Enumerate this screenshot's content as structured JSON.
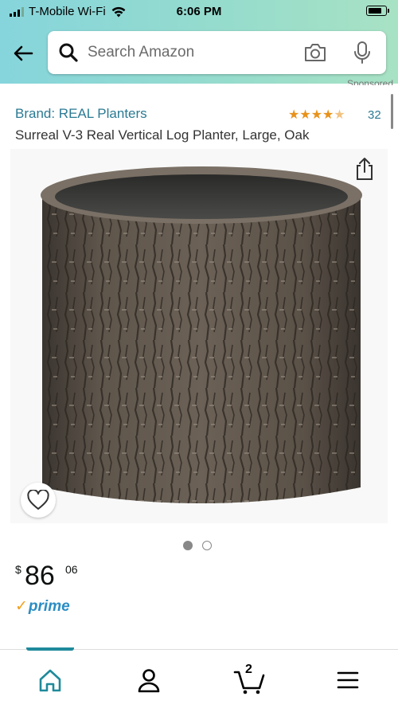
{
  "status_bar": {
    "carrier": "T-Mobile Wi-Fi",
    "time": "6:06 PM",
    "battery_level": 0.8
  },
  "search": {
    "placeholder": "Search Amazon",
    "icons": [
      "back-arrow-icon",
      "search-icon",
      "camera-icon",
      "microphone-icon"
    ]
  },
  "sponsored_label": "Sponsored",
  "product": {
    "brand": "Brand: REAL Planters",
    "rating": 4.5,
    "rating_count": "32",
    "title": "Surreal V-3 Real Vertical Log Planter, Large, Oak",
    "image_count": 2,
    "active_image": 1,
    "price": {
      "currency": "$",
      "whole": "86",
      "fraction": "06"
    },
    "prime_label": "prime"
  },
  "bottom_nav": {
    "items": [
      "home-icon",
      "account-icon",
      "cart-icon",
      "menu-icon"
    ],
    "active": "home",
    "cart_count": "2"
  },
  "colors": {
    "header_gradient_start": "#86d5dc",
    "header_gradient_end": "#a8e2c4",
    "link": "#2b7a93",
    "star": "#e8921a",
    "prime": "#2b8dc4",
    "nav_accent": "#1f8a9b"
  }
}
